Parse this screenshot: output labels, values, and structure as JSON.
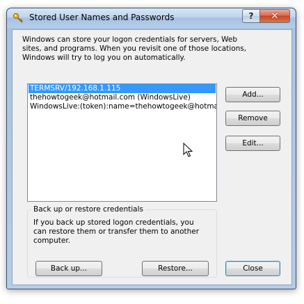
{
  "window": {
    "title": "Stored User Names and Passwords",
    "help_label": "?",
    "close_label": "✕"
  },
  "description": "Windows can store your logon credentials for servers, Web sites, and programs. When you revisit one of those locations, Windows will try to log you on automatically.",
  "credentials": [
    {
      "label": "TERMSRV/192.168.1.115",
      "selected": true
    },
    {
      "label": "thehowtogeek@hotmail.com (WindowsLive)",
      "selected": false
    },
    {
      "label": "WindowsLive:(token):name=thehowtogeek@hotmail.com",
      "selected": false
    }
  ],
  "buttons": {
    "add": "Add...",
    "remove": "Remove",
    "edit": "Edit...",
    "backup": "Back up...",
    "restore": "Restore...",
    "close": "Close"
  },
  "backup_group": {
    "title": "Back up or restore credentials",
    "description": "If you back up stored logon credentials, you can restore them or transfer them to another computer."
  }
}
